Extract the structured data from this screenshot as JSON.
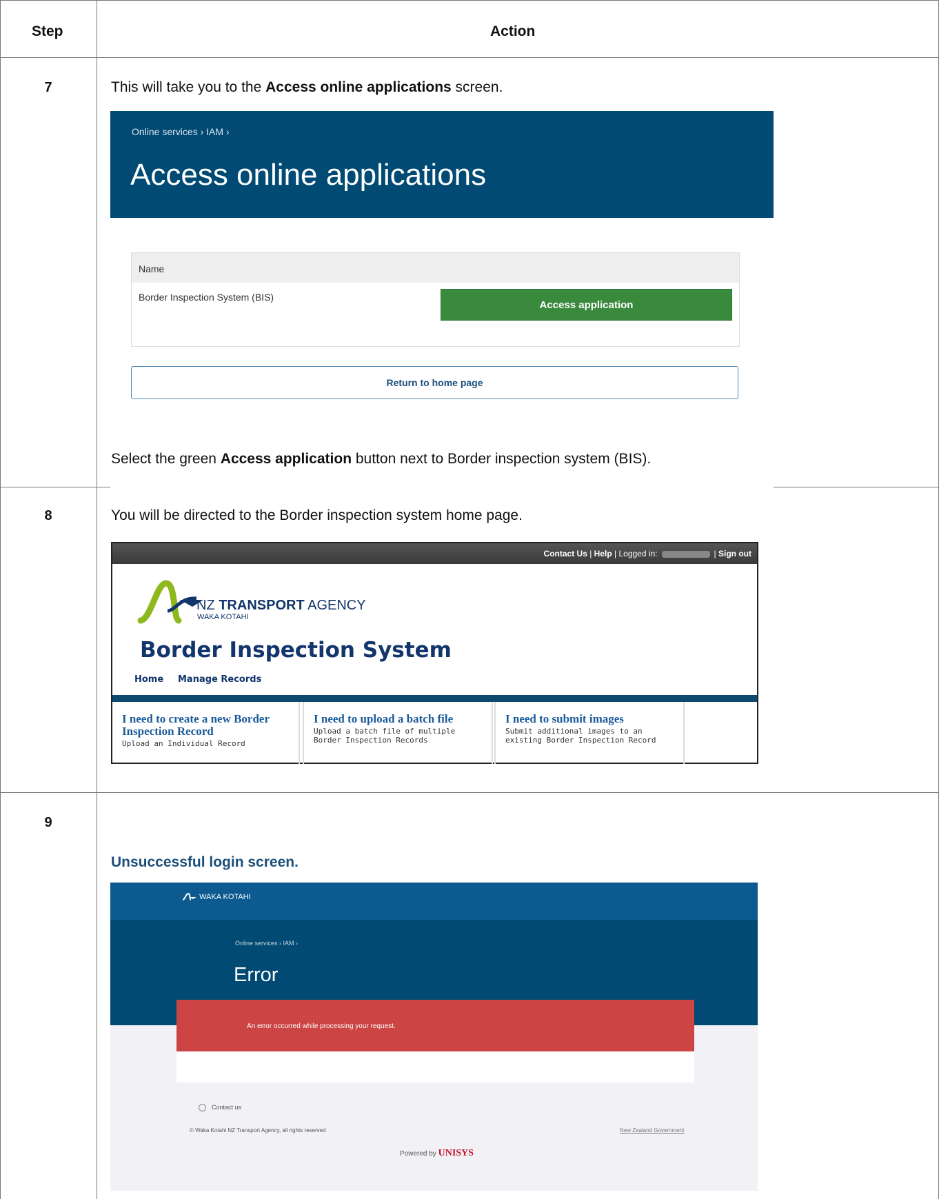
{
  "table": {
    "header_step": "Step",
    "header_action": "Action"
  },
  "row7": {
    "step": "7",
    "intro_pre": "This will take you to the ",
    "intro_bold": "Access online applications",
    "intro_post": " screen.",
    "outro_pre": "Select the green ",
    "outro_bold": "Access application",
    "outro_post": " button next to Border inspection system (BIS).",
    "screenshot": {
      "breadcrumb": "Online services › IAM ›",
      "title": "Access online applications",
      "column_name": "Name",
      "app_name": "Border Inspection System (BIS)",
      "access_button": "Access application",
      "return_button": "Return to home page",
      "colors": {
        "banner": "#004a73",
        "access_button": "#3a8a3e"
      }
    }
  },
  "row8": {
    "step": "8",
    "intro": "You will be directed to the Border inspection system home page.",
    "screenshot": {
      "top_links": {
        "contact": "Contact Us",
        "sep1": " | ",
        "help": "Help",
        "sep2": " | ",
        "logged_in": "Logged in:",
        "sep3": "| ",
        "sign_out": "Sign out"
      },
      "agency_pre": "NZ ",
      "agency_bold": "TRANSPORT",
      "agency_post": " AGENCY",
      "agency_sub": "WAKA KOTAHI",
      "title": "Border Inspection System",
      "nav": [
        "Home",
        "Manage Records"
      ],
      "tiles": [
        {
          "heading": "I need to create a new Border Inspection Record",
          "desc": "Upload an Individual Record"
        },
        {
          "heading": "I need to upload a batch file",
          "desc": "Upload a batch file of multiple Border Inspection Records"
        },
        {
          "heading": "I need to submit images",
          "desc": "Submit additional images to an existing Border Inspection Record"
        }
      ]
    }
  },
  "row9": {
    "step": "9",
    "caption": "Unsuccessful login screen.",
    "screenshot": {
      "logo_text": "WAKA KOTAHI",
      "breadcrumb": "Online services › IAM ›",
      "title": "Error",
      "error_message": "An error occurred while processing your request.",
      "contact": "Contact us",
      "copyright": "© Waka Kotahi NZ Transport Agency, all rights reserved",
      "nz_gov": "New Zealand Government",
      "powered_by": "Powered by ",
      "unisys": "UNISYS",
      "colors": {
        "error_banner": "#cc4444"
      }
    }
  }
}
